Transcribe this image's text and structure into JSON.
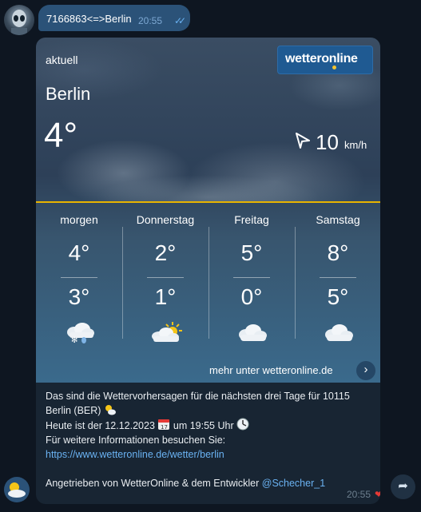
{
  "top_message": {
    "text": "7166863<=>Berlin",
    "time": "20:55",
    "read_ticks": "✓✓"
  },
  "weather": {
    "current_label": "aktuell",
    "logo_text": "wetteronline",
    "city": "Berlin",
    "temperature": "4°",
    "wind_speed": "10",
    "wind_unit": "km/h",
    "accent_color": "#e8b400",
    "forecast": [
      {
        "day": "morgen",
        "high": "4°",
        "low": "3°",
        "icon": "snow-rain-cloud-icon"
      },
      {
        "day": "Donnerstag",
        "high": "2°",
        "low": "1°",
        "icon": "sun-cloud-icon"
      },
      {
        "day": "Freitag",
        "high": "5°",
        "low": "0°",
        "icon": "cloud-icon"
      },
      {
        "day": "Samstag",
        "high": "8°",
        "low": "5°",
        "icon": "cloud-icon"
      }
    ],
    "more_link": "mehr unter wetteronline.de",
    "more_button_icon": "›"
  },
  "message_text": {
    "line1": "Das sind die Wettervorhersagen für die nächsten drei Tage für 10115",
    "line2_text": "Berlin (BER)",
    "line3_a": "Heute ist der 12.12.2023",
    "line3_b": "um 19:55 Uhr",
    "line4": "Für weitere Informationen besuchen Sie:",
    "link": "https://www.wetteronline.de/wetter/berlin",
    "footer_a": "Angetrieben von WetterOnline & dem Entwickler",
    "footer_mention": "@Schecher_1",
    "time": "20:55",
    "reaction": "❤"
  },
  "share_icon": "➦"
}
